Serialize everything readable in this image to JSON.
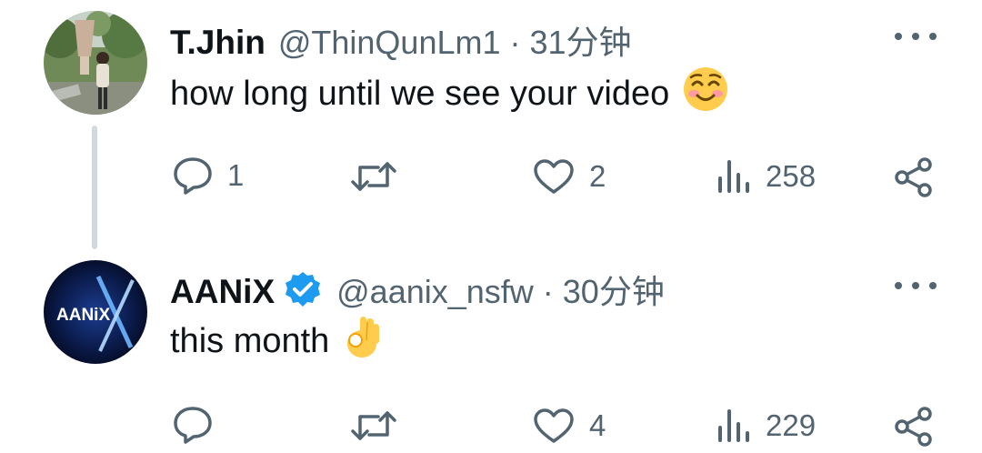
{
  "tweets": [
    {
      "name": "T.Jhin",
      "handle": "@ThinQunLm1",
      "separator": "·",
      "time": "31分钟",
      "text": "how long until we see your video",
      "emoji": "smiling-face-with-smiling-eyes",
      "replies": "1",
      "retweets": "",
      "likes": "2",
      "views": "258",
      "verified": false
    },
    {
      "name": "AANiX",
      "handle": "@aanix_nsfw",
      "separator": "·",
      "time": "30分钟",
      "text": "this month",
      "emoji": "ok-hand",
      "avatar_text": "AANiX",
      "replies": "",
      "retweets": "",
      "likes": "4",
      "views": "229",
      "verified": true
    }
  ],
  "colors": {
    "text_primary": "#0f1419",
    "text_secondary": "#536471",
    "verified_blue": "#1d9bf0",
    "thread_line": "#cfd9de"
  }
}
